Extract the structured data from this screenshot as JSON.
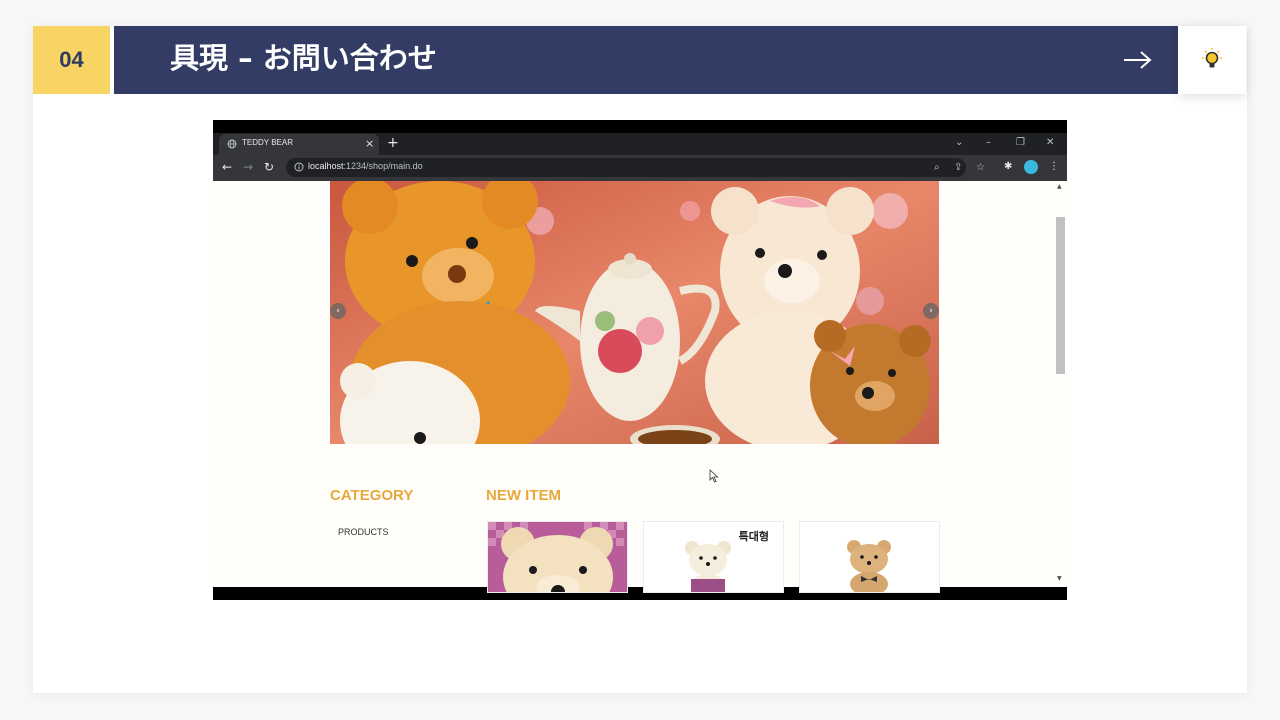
{
  "slide": {
    "number": "04",
    "title": "具現 – お問い合わせ",
    "arrow_icon": "right-arrow-icon",
    "bulb_icon": "lightbulb-icon",
    "colors": {
      "number_bg": "#f8d465",
      "title_bg": "#323c64",
      "text": "#ffffff"
    }
  },
  "browser": {
    "tab_title": "TEDDY BEAR",
    "close_glyph": "×",
    "new_tab_glyph": "+",
    "window_controls": [
      "⌄",
      "–",
      "❐",
      "✕"
    ],
    "nav": {
      "back": "←",
      "forward": "→",
      "reload": "↻"
    },
    "url_host": "localhost",
    "url_path": ":1234/shop/main.do",
    "toolbar_icons": [
      "zoom-icon",
      "share-icon",
      "star-icon",
      "extensions-icon",
      "profile-icon",
      "menu-icon"
    ]
  },
  "shop": {
    "carousel_prev": "‹",
    "carousel_next": "›",
    "category_heading": "CATEGORY",
    "category_items": [
      "PRODUCTS"
    ],
    "new_item_heading": "NEW ITEM",
    "products": [
      {
        "label": ""
      },
      {
        "label": "특대형"
      },
      {
        "label": ""
      }
    ],
    "heading_color": "#e8a83c"
  }
}
